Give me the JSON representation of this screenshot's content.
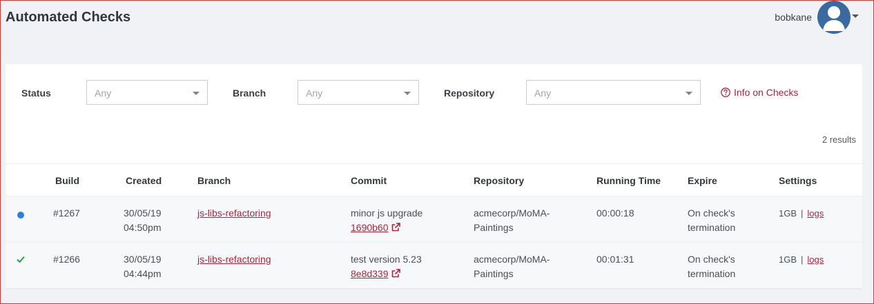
{
  "header": {
    "title": "Automated Checks",
    "username": "bobkane"
  },
  "filters": {
    "status_label": "Status",
    "status_value": "Any",
    "branch_label": "Branch",
    "branch_value": "Any",
    "repository_label": "Repository",
    "repository_value": "Any",
    "info_link": "Info on Checks"
  },
  "results_count": "2 results",
  "table": {
    "columns": [
      "Build",
      "Created",
      "Branch",
      "Commit",
      "Repository",
      "Running Time",
      "Expire",
      "Settings"
    ],
    "rows": [
      {
        "status_icon": "running-dot",
        "build": "#1267",
        "created_date": "30/05/19",
        "created_time": "04:50pm",
        "branch": "js-libs-refactoring",
        "commit_msg": "minor js upgrade",
        "commit_hash": "1690b60",
        "repo_line1": "acmecorp/MoMA-",
        "repo_line2": "Paintings",
        "running_time": "00:00:18",
        "expire_line1": "On check's",
        "expire_line2": "termination",
        "memory": "1GB",
        "sep": "|",
        "logs": "logs"
      },
      {
        "status_icon": "success-check",
        "build": "#1266",
        "created_date": "30/05/19",
        "created_time": "04:44pm",
        "branch": "js-libs-refactoring",
        "commit_msg": "test version 5.23",
        "commit_hash": "8e8d339",
        "repo_line1": "acmecorp/MoMA-",
        "repo_line2": "Paintings",
        "running_time": "00:01:31",
        "expire_line1": "On check's",
        "expire_line2": "termination",
        "memory": "1GB",
        "sep": "|",
        "logs": "logs"
      }
    ]
  },
  "colors": {
    "accent": "#b0243a",
    "running": "#2d7ee2",
    "success": "#2e9a4a",
    "avatar": "#3b6aa0"
  }
}
